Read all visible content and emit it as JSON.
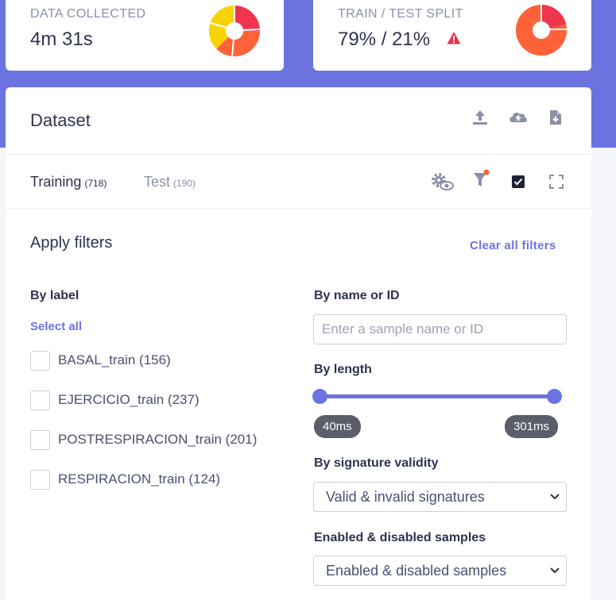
{
  "stats": {
    "data_collected": {
      "label": "DATA COLLECTED",
      "value": "4m 31s"
    },
    "train_test": {
      "label": "TRAIN / TEST SPLIT",
      "value": "79% / 21%"
    }
  },
  "dataset": {
    "title": "Dataset",
    "icons": [
      "upload-icon",
      "cloud-upload-icon",
      "file-download-icon"
    ]
  },
  "tabs": [
    {
      "name": "Training",
      "count": "(718)"
    },
    {
      "name": "Test",
      "count": "(190)"
    }
  ],
  "toolbar_icons": [
    "settings-view-icon",
    "filter-icon",
    "checkbox-checked-icon",
    "fullscreen-icon"
  ],
  "filters": {
    "title": "Apply filters",
    "clear_all": "Clear all filters",
    "by_label": {
      "title": "By label",
      "select_all": "Select all",
      "items": [
        "BASAL_train (156)",
        "EJERCICIO_train (237)",
        "POSTRESPIRACION_train (201)",
        "RESPIRACION_train (124)"
      ]
    },
    "by_name": {
      "title": "By name or ID",
      "placeholder": "Enter a sample name or ID"
    },
    "by_length": {
      "title": "By length",
      "min_label": "40ms",
      "max_label": "301ms"
    },
    "by_signature": {
      "title": "By signature validity",
      "selected": "Valid & invalid signatures"
    },
    "enabled": {
      "title": "Enabled & disabled samples",
      "selected": "Enabled & disabled samples"
    }
  },
  "colors": {
    "accent": "#6a73e0",
    "donut_red": "#f0354f",
    "donut_orange": "#ff6138",
    "donut_yellow": "#fad305",
    "donut_green": "#2ec97a",
    "warning": "#e8334f"
  }
}
